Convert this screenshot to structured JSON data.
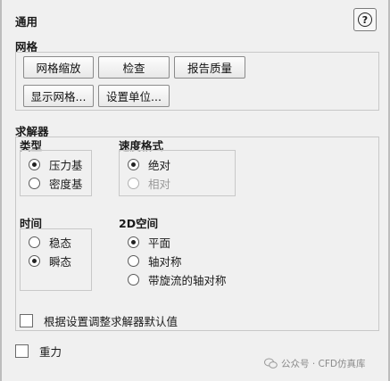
{
  "panel": {
    "title": "通用",
    "help_symbol": "?"
  },
  "mesh": {
    "title": "网格",
    "buttons": [
      "网格缩放",
      "检查",
      "报告质量",
      "显示网格...",
      "设置单位..."
    ]
  },
  "solver": {
    "title": "求解器",
    "type": {
      "title": "类型",
      "options": [
        "压力基",
        "密度基"
      ],
      "selected": "压力基"
    },
    "velocity_formulation": {
      "title": "速度格式",
      "options": [
        "绝对",
        "相对"
      ],
      "selected": "绝对",
      "disabled": [
        "相对"
      ]
    },
    "time": {
      "title": "时间",
      "options": [
        "稳态",
        "瞬态"
      ],
      "selected": "瞬态"
    },
    "space_2d": {
      "title": "2D空间",
      "options": [
        "平面",
        "轴对称",
        "带旋流的轴对称"
      ],
      "selected": "平面"
    },
    "adjust_defaults_label": "根据设置调整求解器默认值",
    "adjust_defaults_checked": false
  },
  "gravity": {
    "label": "重力",
    "checked": false
  },
  "watermark": "公众号 · CFD仿真库"
}
